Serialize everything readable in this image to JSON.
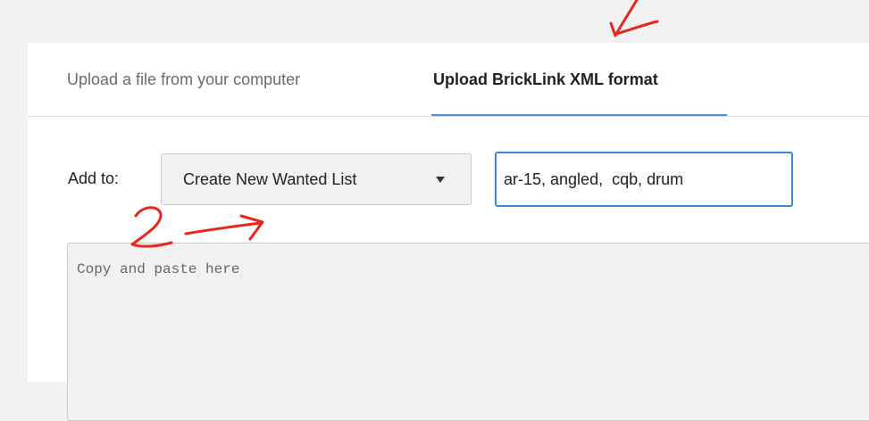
{
  "tabs": [
    {
      "label": "Upload a file from your computer",
      "active": false
    },
    {
      "label": "Upload BrickLink XML format",
      "active": true
    }
  ],
  "form": {
    "add_to_label": "Add to:",
    "list_dropdown": {
      "selected": "Create New Wanted List"
    },
    "tag_input": {
      "value": "ar-15, angled,  cqb, drum"
    },
    "paste_area": {
      "placeholder": "Copy and paste here",
      "value": ""
    }
  },
  "annotations": {
    "step_number": "2",
    "stroke_color": "#e8261c"
  },
  "colors": {
    "accent": "#4a90d9",
    "input_border": "#3b8ad8",
    "panel_background": "#ffffff",
    "page_background": "#f2f2f2"
  }
}
